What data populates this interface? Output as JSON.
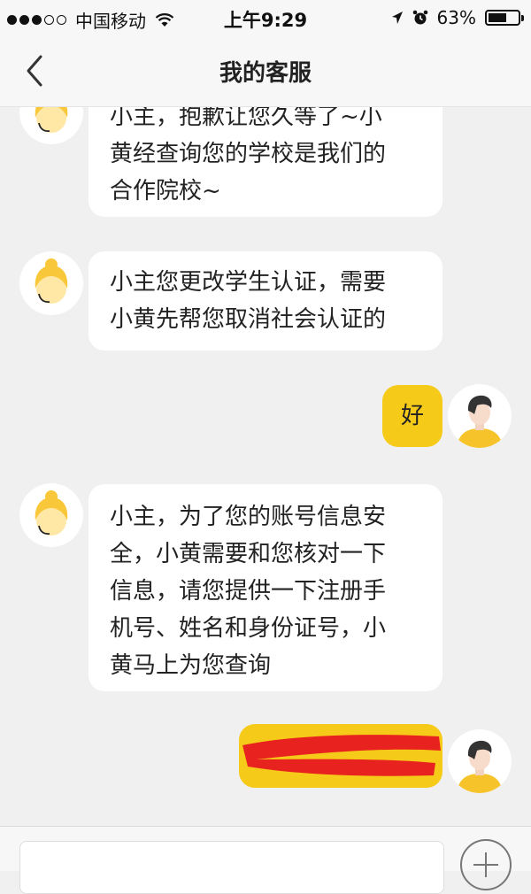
{
  "status_bar": {
    "carrier": "中国移动",
    "time": "上午9:29",
    "battery": "63%",
    "battery_level": 0.63,
    "icons": [
      "signal-dots-icon",
      "wifi-icon",
      "location-arrow-icon",
      "alarm-clock-icon",
      "battery-icon"
    ]
  },
  "nav": {
    "title": "我的客服",
    "back_icon": "chevron-left-icon"
  },
  "messages": [
    {
      "sender": "agent",
      "lines": [
        "小主，抱歉让您久等了~小",
        "黄经查询您的学校是我们的",
        "合作院校~"
      ]
    },
    {
      "sender": "agent",
      "lines": [
        "小主您更改学生认证，需要",
        "小黄先帮您取消社会认证的"
      ]
    },
    {
      "sender": "user",
      "lines": [
        "好"
      ]
    },
    {
      "sender": "agent",
      "lines": [
        "小主，为了您的账号信息安",
        "全，小黄需要和您核对一下",
        "信息，请您提供一下注册手",
        "机号、姓名和身份证号，小",
        "黄马上为您查询"
      ]
    },
    {
      "sender": "user",
      "lines": [],
      "redacted": true,
      "redaction_color": "#e8231f"
    }
  ],
  "colors": {
    "user_bubble": "#f6ca18",
    "agent_bubble": "#ffffff",
    "chat_background": "#f0f0f0",
    "agent_avatar": "#f9c83a",
    "user_avatar_shirt": "#f6c42a"
  },
  "input_bar": {
    "placeholder": "",
    "add_icon": "plus-circle-icon"
  }
}
